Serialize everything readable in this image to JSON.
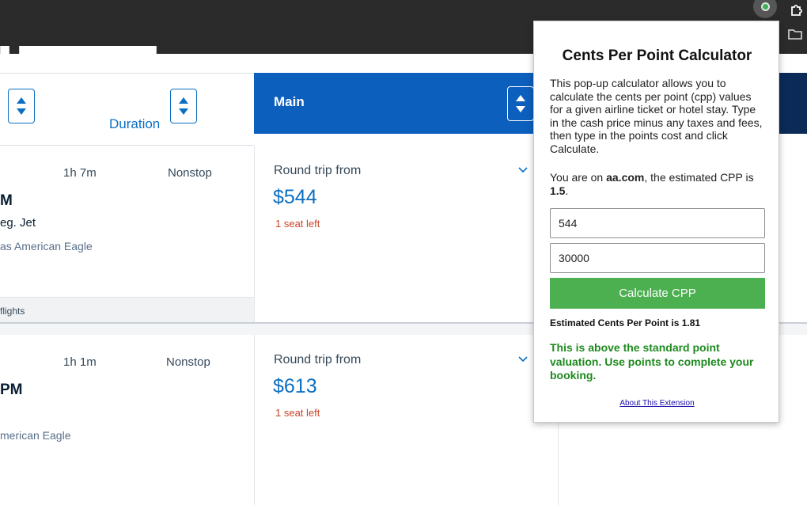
{
  "browser": {
    "icons": [
      "extension-active-icon",
      "puzzle-icon",
      "folder-icon"
    ]
  },
  "sort_bar": {
    "duration_label": "Duration",
    "main_label": "Main"
  },
  "results": [
    {
      "duration": "1h 7m",
      "stops": "Nonstop",
      "time_partial": "M",
      "aircraft_partial": "eg. Jet",
      "operator_partial": "as American Eagle",
      "fare_label": "Round trip from",
      "price": "$544",
      "seats": "1 seat left",
      "footer_partial": "flights"
    },
    {
      "duration": "1h 1m",
      "stops": "Nonstop",
      "time_partial": "PM",
      "operator_partial": "merican Eagle",
      "fare_label": "Round trip from",
      "price": "$613",
      "seats": "1 seat left"
    }
  ],
  "popup": {
    "title": "Cents Per Point Calculator",
    "description": "This pop-up calculator allows you to calculate the cents per point (cpp) values for a given airline ticket or hotel stay. Type in the cash price minus any taxes and fees, then type in the points cost and click Calculate.",
    "site_prefix": "You are on ",
    "site_name": "aa.com",
    "site_middle": ", the estimated CPP is ",
    "site_cpp": "1.5",
    "site_suffix": ".",
    "cash_price_value": "544",
    "points_value": "30000",
    "calculate_label": "Calculate CPP",
    "result_text": "Estimated Cents Per Point is 1.81",
    "verdict_text": "This is above the standard point valuation. Use points to complete your booking.",
    "about_link": "About This Extension"
  },
  "colors": {
    "accent_blue": "#0d6fc2",
    "header_blue": "#0d5fbd",
    "calc_green": "#4caf50",
    "verdict_green": "#1e8a1e",
    "seats_red": "#c9442a"
  }
}
